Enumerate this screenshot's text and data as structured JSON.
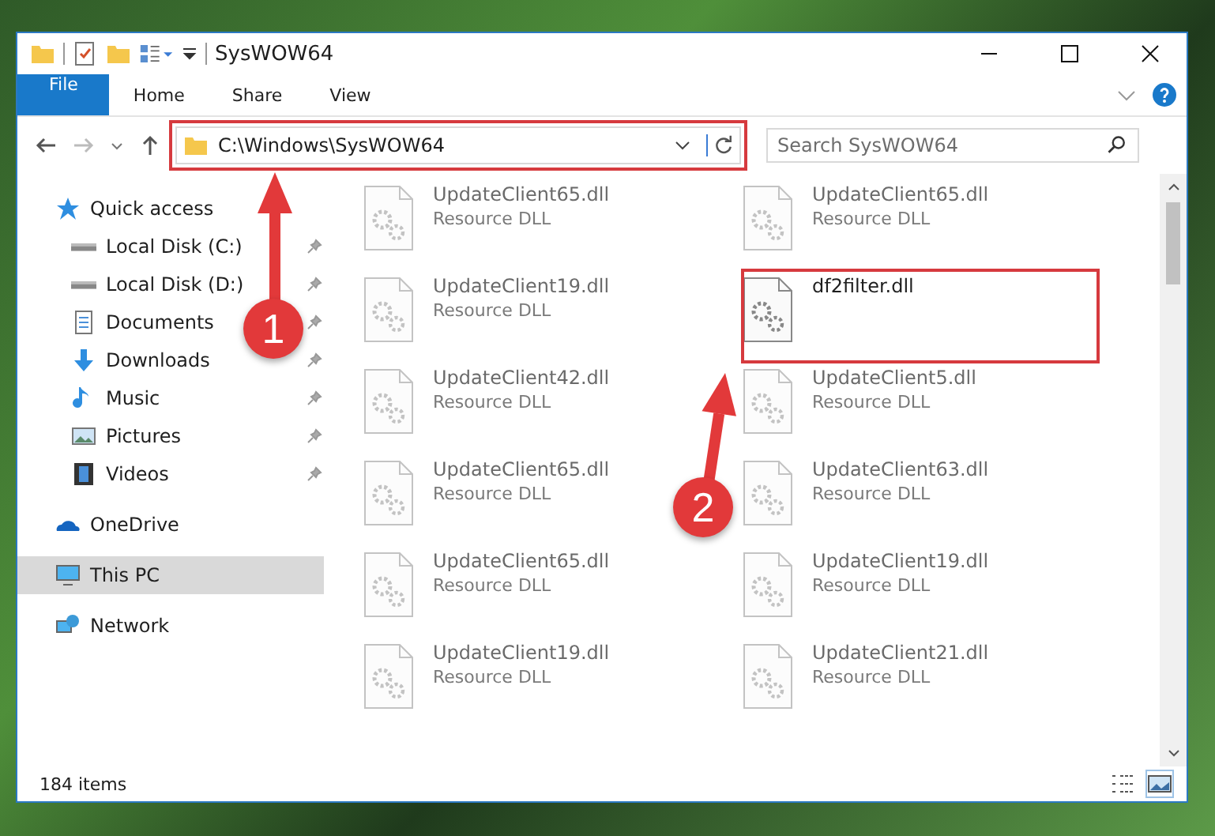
{
  "window": {
    "title": "SysWOW64"
  },
  "ribbon_tabs": [
    {
      "label": "File",
      "kind": "file",
      "selected": false
    },
    {
      "label": "Home",
      "kind": "tab",
      "selected": false
    },
    {
      "label": "Share",
      "kind": "tab",
      "selected": false
    },
    {
      "label": "View",
      "kind": "tab",
      "selected": false
    }
  ],
  "address_bar": {
    "path": "C:\\Windows\\SysWOW64",
    "highlighted": true
  },
  "search": {
    "placeholder": "Search SysWOW64"
  },
  "nav": [
    {
      "label": "Quick access",
      "kind": "star",
      "selected": false,
      "children": [
        {
          "label": "Local Disk (C:)",
          "kind": "drive",
          "pinned": true,
          "selected": false
        },
        {
          "label": "Local Disk (D:)",
          "kind": "drive",
          "pinned": true,
          "selected": false
        },
        {
          "label": "Documents",
          "kind": "docs",
          "pinned": true,
          "selected": false
        },
        {
          "label": "Downloads",
          "kind": "downloads",
          "pinned": true,
          "selected": false
        },
        {
          "label": "Music",
          "kind": "music",
          "pinned": true,
          "selected": false
        },
        {
          "label": "Pictures",
          "kind": "pictures",
          "pinned": true,
          "selected": false
        },
        {
          "label": "Videos",
          "kind": "videos",
          "pinned": true,
          "selected": false
        }
      ]
    },
    {
      "label": "OneDrive",
      "kind": "cloud",
      "selected": false
    },
    {
      "label": "This PC",
      "kind": "pc",
      "selected": true
    },
    {
      "label": "Network",
      "kind": "network",
      "selected": false
    }
  ],
  "files": [
    {
      "name": "UpdateClient65.dll",
      "type": "Resource DLL",
      "blurred": true
    },
    {
      "name": "UpdateClient65.dll",
      "type": "Resource DLL",
      "blurred": true
    },
    {
      "name": "UpdateClient19.dll",
      "type": "Resource DLL",
      "blurred": true
    },
    {
      "name": "df2filter.dll",
      "blurred": false,
      "highlighted": true
    },
    {
      "name": "UpdateClient42.dll",
      "type": "Resource DLL",
      "blurred": true
    },
    {
      "name": "UpdateClient5.dll",
      "type": "Resource DLL",
      "blurred": true
    },
    {
      "name": "UpdateClient65.dll",
      "type": "Resource DLL",
      "blurred": true
    },
    {
      "name": "UpdateClient63.dll",
      "type": "Resource DLL",
      "blurred": true
    },
    {
      "name": "UpdateClient65.dll",
      "type": "Resource DLL",
      "blurred": true
    },
    {
      "name": "UpdateClient19.dll",
      "type": "Resource DLL",
      "blurred": true
    },
    {
      "name": "UpdateClient19.dll",
      "type": "Resource DLL",
      "blurred": true
    },
    {
      "name": "UpdateClient21.dll",
      "type": "Resource DLL",
      "blurred": true
    }
  ],
  "status_bar": {
    "count": "184 items"
  },
  "callouts": [
    {
      "number": "1"
    },
    {
      "number": "2"
    }
  ]
}
